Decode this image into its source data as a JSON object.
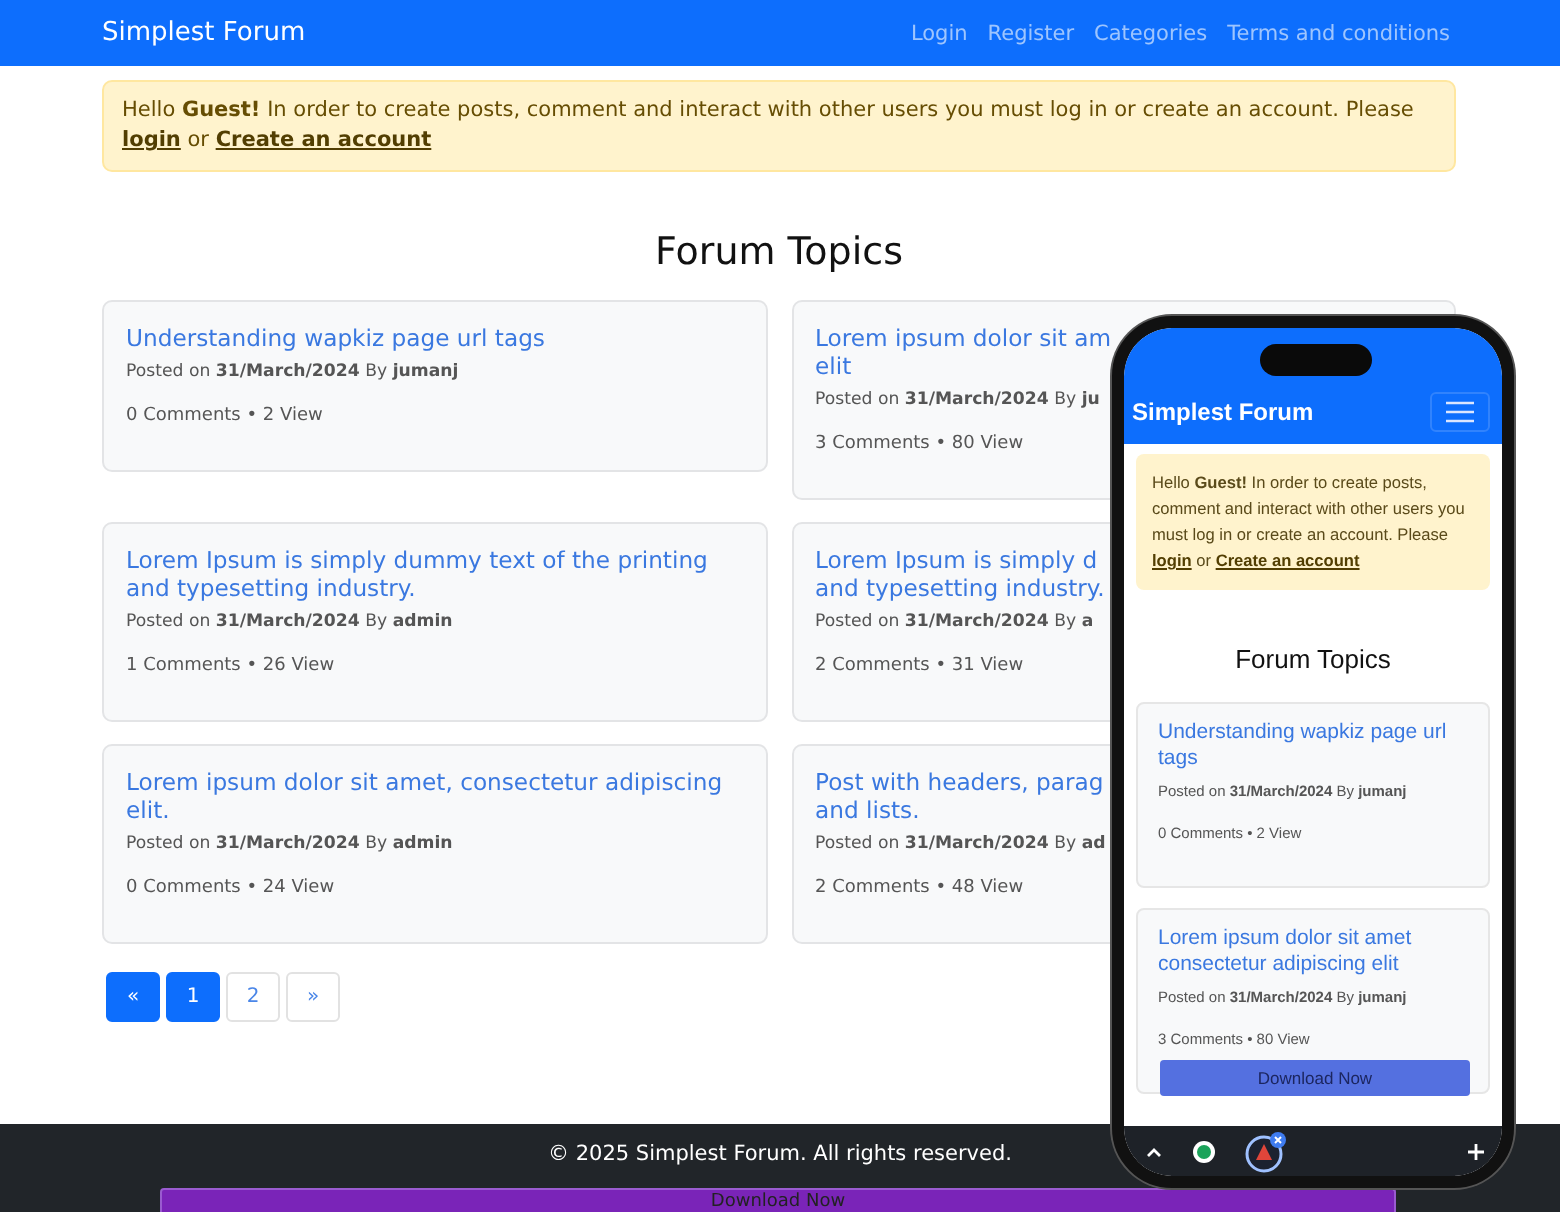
{
  "navbar": {
    "brand": "Simplest Forum",
    "links": [
      "Login",
      "Register",
      "Categories",
      "Terms and conditions"
    ]
  },
  "alert": {
    "text": "Hello **Guest!** In order to create posts, comment and interact with other users you must log in or create an account. Please ",
    "login_link": "login",
    "joiner": "or",
    "account_link": "Create an account"
  },
  "heading": "Forum Topics",
  "topics": [
    {
      "title": "Understanding wapkiz page url tags",
      "meta": "Posted on **31/March/2024** By **jumanj**",
      "stats": "0 Comments • 2 View"
    },
    {
      "title": "Lorem ipsum dolor sit am\nelit",
      "meta": "Posted on **31/March/2024** By **ju**",
      "stats": "3 Comments • 80 View"
    },
    {
      "title": "Lorem Ipsum is simply dummy text of the printing and typesetting industry.",
      "meta": "Posted on **31/March/2024** By **admin**",
      "stats": "1 Comments • 26 View"
    },
    {
      "title": "Lorem Ipsum is simply d\nand typesetting industry.",
      "meta": "Posted on **31/March/2024** By **a**",
      "stats": "2 Comments • 31 View"
    },
    {
      "title": "Lorem ipsum dolor sit amet, consectetur adipiscing elit.",
      "meta": "Posted on **31/March/2024** By **admin**",
      "stats": "0 Comments • 24 View"
    },
    {
      "title": "Post with headers, parag\nand lists.",
      "meta": "Posted on **31/March/2024** By **ad**",
      "stats": "2 Comments • 48 View"
    }
  ],
  "pagination": [
    {
      "label": "«",
      "selected": true
    },
    {
      "label": "1",
      "selected": true
    },
    {
      "label": "2",
      "selected": false
    },
    {
      "label": "»",
      "selected": false
    }
  ],
  "footer": "© 2025 Simplest Forum. All rights reserved.",
  "download_bar": "Download Now",
  "phone": {
    "brand": "Simplest Forum",
    "alert": {
      "text": "Hello **Guest!** In order to create posts, comment and interact with other users you must log in or create an account. Please ",
      "login_link": "login",
      "joiner": "or",
      "account_link": "Create an account"
    },
    "heading": "Forum Topics",
    "topics": [
      {
        "title": "Understanding wapkiz page url tags",
        "meta": "Posted on **31/March/2024** By **jumanj**",
        "stats": "0 Comments • 2 View"
      },
      {
        "title": "Lorem ipsum dolor sit amet consectetur adipiscing elit",
        "meta": "Posted on **31/March/2024** By **jumanj**",
        "stats": "3 Comments • 80 View"
      }
    ],
    "download_button": "Download Now"
  }
}
